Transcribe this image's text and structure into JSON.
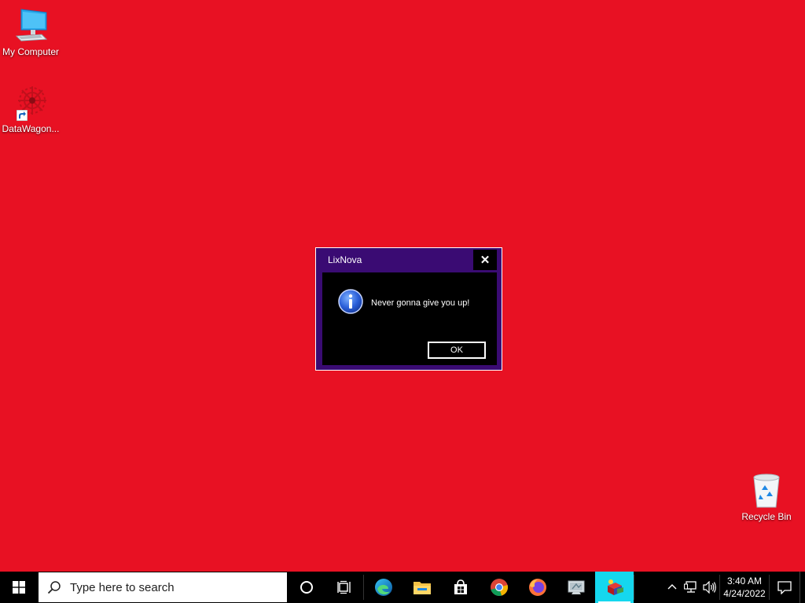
{
  "desktop": {
    "background_color": "#e81123",
    "icons": [
      {
        "label": "My Computer",
        "icon": "monitor-icon"
      },
      {
        "label": "DataWagon...",
        "icon": "datawagon-icon"
      },
      {
        "label": "Recycle Bin",
        "icon": "recycle-bin-icon"
      }
    ]
  },
  "dialog": {
    "title": "LixNova",
    "close_glyph": "✕",
    "message": "Never gonna give you up!",
    "ok_label": "OK",
    "icon": "info-icon",
    "frame_color": "#3a0b73"
  },
  "taskbar": {
    "search_placeholder": "Type here to search",
    "pinned_apps": [
      {
        "name": "Microsoft Edge",
        "icon": "edge-icon"
      },
      {
        "name": "File Explorer",
        "icon": "folder-icon"
      },
      {
        "name": "Microsoft Store",
        "icon": "store-icon"
      },
      {
        "name": "Google Chrome",
        "icon": "chrome-icon"
      },
      {
        "name": "Firefox",
        "icon": "firefox-icon"
      },
      {
        "name": "Control Panel",
        "icon": "control-panel-icon"
      },
      {
        "name": "LixNova",
        "icon": "lixnova-app-icon",
        "active": true
      }
    ],
    "clock": {
      "time": "3:40 AM",
      "date": "4/24/2022"
    },
    "active_color": "#15d7ee"
  }
}
